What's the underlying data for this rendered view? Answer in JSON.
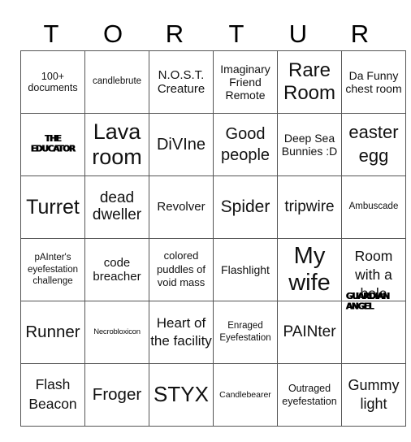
{
  "card": {
    "header_letters": [
      "T",
      "O",
      "R",
      "T",
      "U",
      "R"
    ],
    "rows": [
      [
        "100+ documents",
        "candlebrute",
        "N.O.S.T. Creature",
        "Imaginary Friend Remote",
        "Rare Room",
        "Da Funny chest room"
      ],
      [
        "THE EDUCATOR",
        "Lava room",
        "DiVIne",
        "Good people",
        "Deep Sea Bunnies :D",
        "easter egg"
      ],
      [
        "Turret",
        "dead dweller",
        "Revolver",
        "Spider",
        "tripwire",
        "Ambuscade"
      ],
      [
        "pAInter's eyefestation challenge",
        "code breacher",
        "colored puddles of void mass",
        "Flashlight",
        "My wife",
        "Room with a hole"
      ],
      [
        "Runner",
        "Necrobloxicon",
        "Heart of the facility",
        "Enraged Eyefestation",
        "PAINter",
        "GUARDIAN ANGEL"
      ],
      [
        "Flash Beacon",
        "Froger",
        "STYX",
        "Candlebearer",
        "Outraged eyefestation",
        "Gummy light"
      ]
    ]
  }
}
